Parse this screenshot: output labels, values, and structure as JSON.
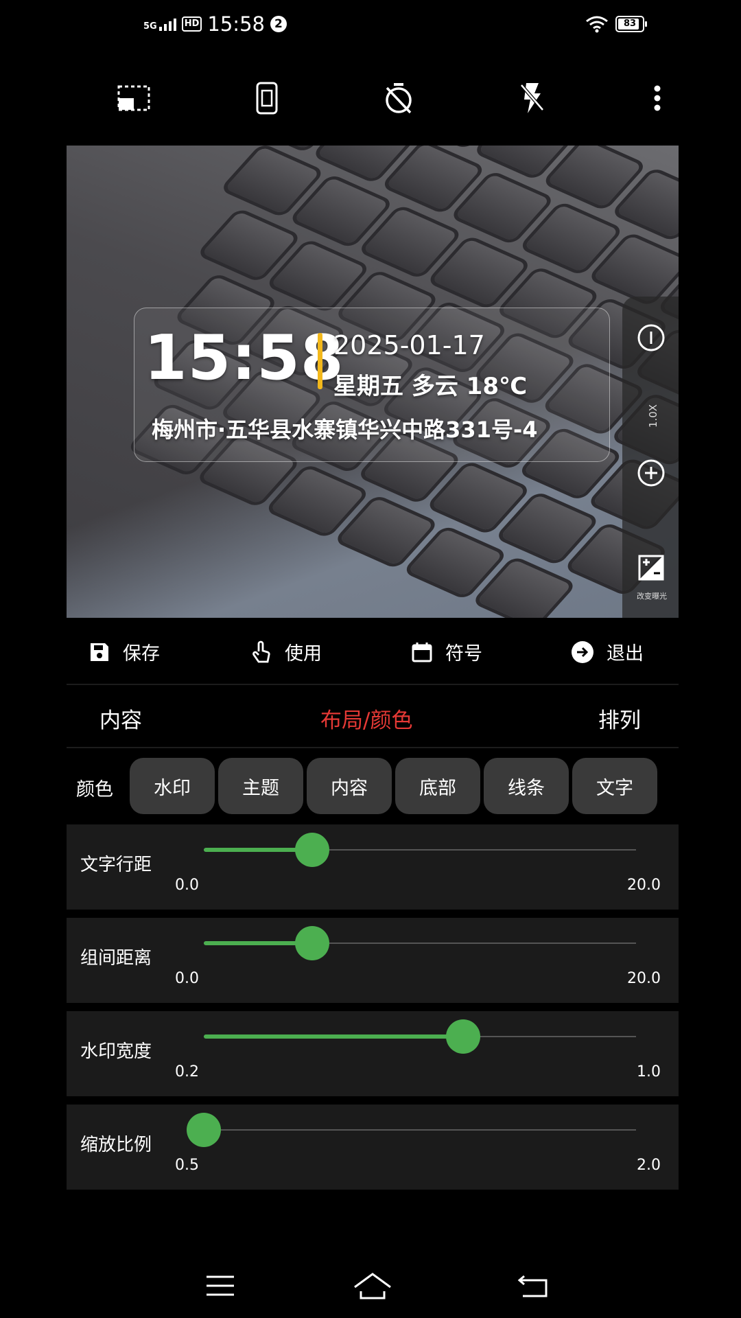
{
  "status_bar": {
    "network": "5G",
    "hd_badge": "HD",
    "time": "15:58",
    "notification_count": "2",
    "battery": "83"
  },
  "toolbar": {
    "icons": [
      "aspect-ratio-icon",
      "phone-frame-icon",
      "timer-off-icon",
      "flash-off-icon",
      "more-vertical-icon"
    ]
  },
  "watermark": {
    "time": "15:58",
    "date": "2025-01-17",
    "weekday_weather": "星期五  多云 18℃",
    "address": "梅州市·五华县水寨镇华兴中路331号-4",
    "bar_color": "#f3b81b"
  },
  "zoom": {
    "level": "1.0X",
    "exposure_label": "改变曝光"
  },
  "actions": {
    "save": "保存",
    "use": "使用",
    "symbol": "符号",
    "exit": "退出"
  },
  "tabs": {
    "items": [
      "内容",
      "布局/颜色",
      "排列"
    ],
    "active_index": 1,
    "active_color": "#e53935"
  },
  "color_row": {
    "label": "颜色",
    "chips": [
      "水印",
      "主题",
      "内容",
      "底部",
      "线条",
      "文字"
    ]
  },
  "sliders": [
    {
      "label": "文字行距",
      "min": "0.0",
      "max": "20.0",
      "fraction": 0.25
    },
    {
      "label": "组间距离",
      "min": "0.0",
      "max": "20.0",
      "fraction": 0.25
    },
    {
      "label": "水印宽度",
      "min": "0.2",
      "max": "1.0",
      "fraction": 0.6
    },
    {
      "label": "缩放比例",
      "min": "0.5",
      "max": "2.0",
      "fraction": 0.0
    }
  ],
  "accent_color": "#4caf50"
}
